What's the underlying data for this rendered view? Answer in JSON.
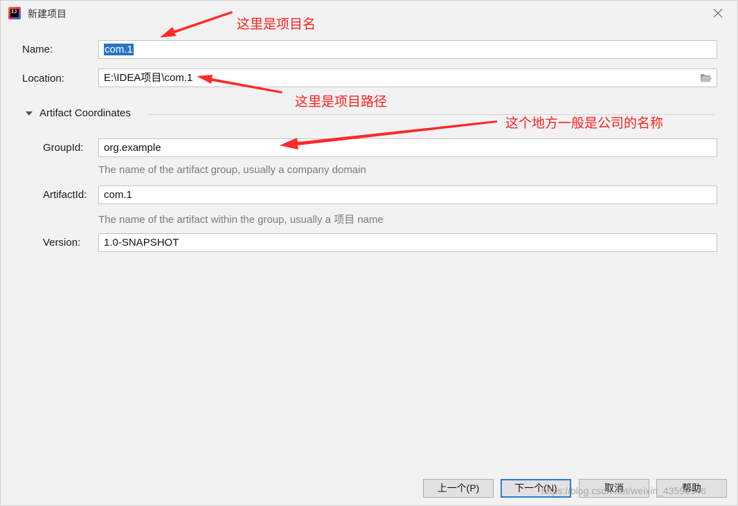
{
  "window": {
    "title": "新建项目"
  },
  "form": {
    "name": {
      "label": "Name:",
      "value": "com.1"
    },
    "location": {
      "label": "Location:",
      "value": "E:\\IDEA项目\\com.1"
    },
    "section": {
      "title": "Artifact Coordinates"
    },
    "group_id": {
      "label": "GroupId:",
      "value": "org.example",
      "hint": "The name of the artifact group, usually a company domain"
    },
    "artifact_id": {
      "label": "ArtifactId:",
      "value": "com.1",
      "hint": "The name of the artifact within the group, usually a 项目 name"
    },
    "version": {
      "label": "Version:",
      "value": "1.0-SNAPSHOT"
    }
  },
  "buttons": {
    "previous": "上一个(P)",
    "next": "下一个(N)",
    "cancel": "取消",
    "help": "帮助"
  },
  "annotations": {
    "project_name": "这里是项目名",
    "project_path": "这里是项目路径",
    "company_name": "这个地方一般是公司的名称",
    "color": "#ff1f1f"
  },
  "watermark": "https://blog.csdn.net/weixin_43590946",
  "icons": {
    "app": "intellij-idea-icon",
    "close": "close-icon",
    "folder": "folder-open-icon",
    "expand": "triangle-down-icon"
  }
}
